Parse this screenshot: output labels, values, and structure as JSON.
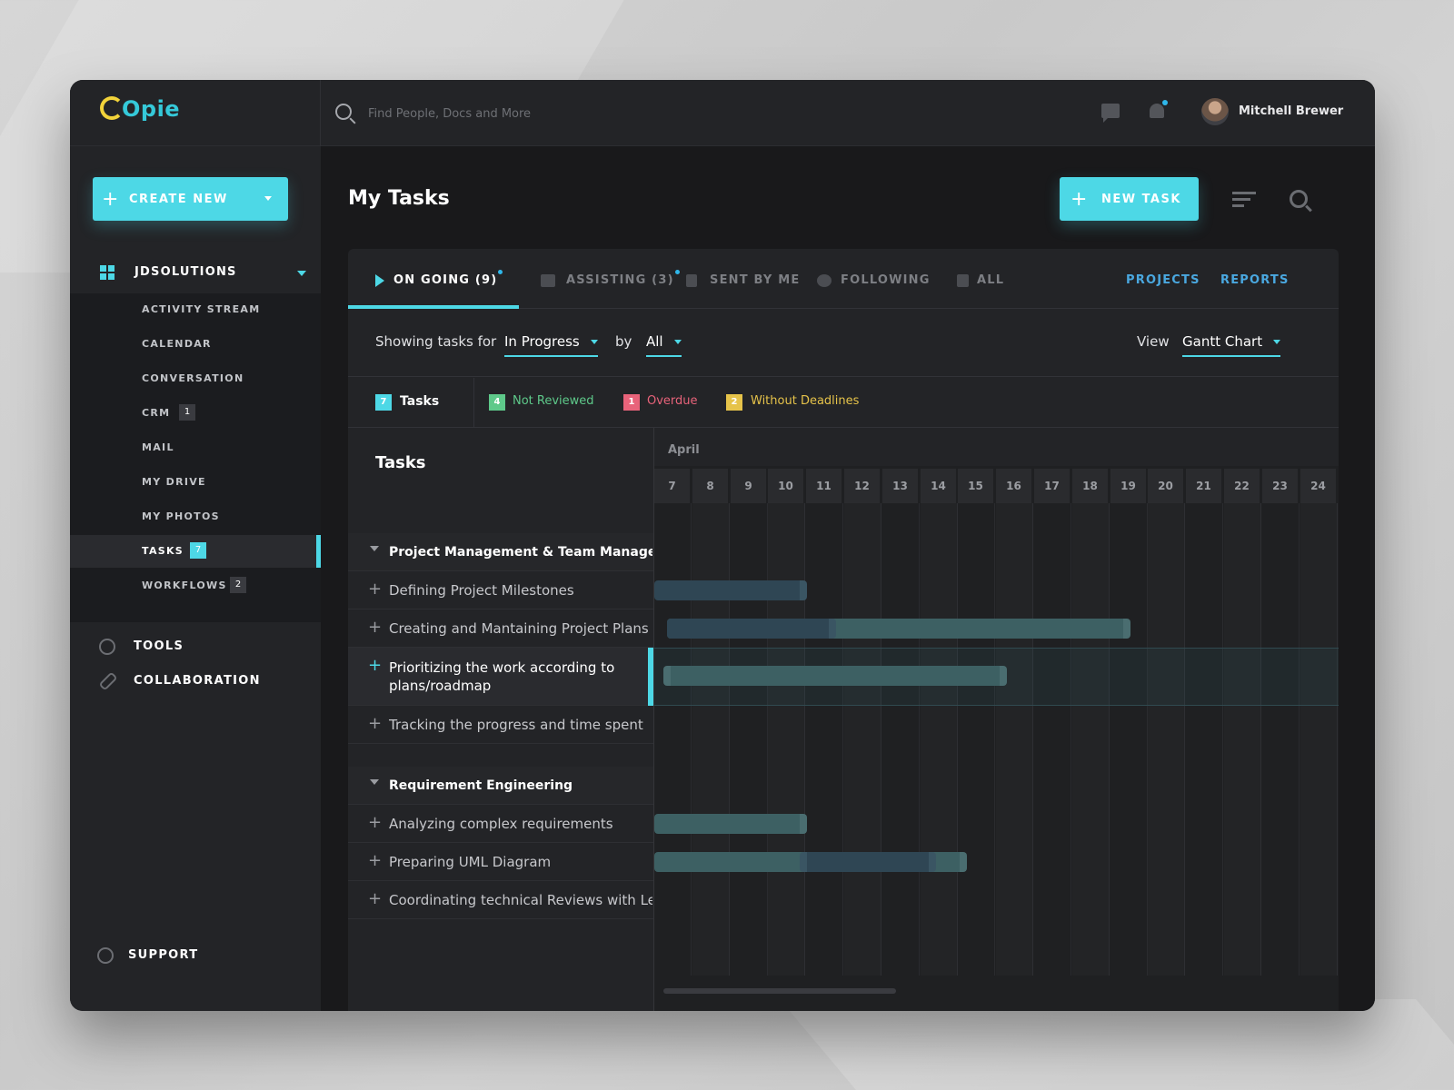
{
  "app": {
    "logo": "Opie",
    "search_placeholder": "Find People, Docs and More",
    "user_name": "Mitchell Brewer"
  },
  "sidebar": {
    "create_label": "CREATE NEW",
    "org_name": "JDSOLUTIONS",
    "items": [
      {
        "label": "ACTIVITY STREAM",
        "badge": ""
      },
      {
        "label": "CALENDAR",
        "badge": ""
      },
      {
        "label": "CONVERSATION",
        "badge": ""
      },
      {
        "label": "CRM",
        "badge": "1"
      },
      {
        "label": "MAIL",
        "badge": ""
      },
      {
        "label": "MY DRIVE",
        "badge": ""
      },
      {
        "label": "MY PHOTOS",
        "badge": ""
      },
      {
        "label": "TASKS",
        "badge": "7",
        "active": true
      },
      {
        "label": "WORKFLOWS",
        "badge": "2"
      }
    ],
    "tools_label": "TOOLS",
    "collaboration_label": "COLLABORATION",
    "support_label": "SUPPORT"
  },
  "main": {
    "title": "My Tasks",
    "new_task_label": "NEW TASK",
    "tabs": [
      {
        "label": "ON GOING (9)",
        "active": true
      },
      {
        "label": "ASSISTING (3)"
      },
      {
        "label": "SENT BY ME"
      },
      {
        "label": "FOLLOWING"
      },
      {
        "label": "ALL"
      }
    ],
    "links": {
      "projects": "PROJECTS",
      "reports": "REPORTS"
    },
    "filters": {
      "showing_label": "Showing tasks for",
      "status_value": "In Progress",
      "by_label": "by",
      "by_value": "All",
      "view_label": "View",
      "view_value": "Gantt Chart"
    },
    "status": {
      "tasks_count": "7",
      "tasks_label": "Tasks",
      "not_reviewed_count": "4",
      "not_reviewed_label": "Not Reviewed",
      "overdue_count": "1",
      "overdue_label": "Overdue",
      "no_deadline_count": "2",
      "no_deadline_label": "Without Deadlines"
    },
    "colors": {
      "accent": "#4dd8e6",
      "not_reviewed": "#5ec98a",
      "overdue": "#e8637a",
      "no_deadline": "#e6c34a",
      "link": "#4aa8e0"
    }
  },
  "gantt": {
    "tasks_heading": "Tasks",
    "month": "April",
    "days": [
      "7",
      "8",
      "9",
      "10",
      "11",
      "12",
      "13",
      "14",
      "15",
      "16",
      "17",
      "18",
      "19",
      "20",
      "21",
      "22",
      "23",
      "24"
    ],
    "groups": [
      {
        "name": "Project Management & Team Management",
        "tasks": [
          "Defining Project Milestones",
          "Creating and Mantaining Project Plans",
          "Prioritizing the work according to plans/roadmap",
          "Tracking the progress and time spent"
        ]
      },
      {
        "name": "Requirement Engineering",
        "tasks": [
          "Analyzing complex requirements",
          "Preparing UML Diagram",
          "Coordinating technical Reviews with Lead"
        ]
      }
    ]
  }
}
